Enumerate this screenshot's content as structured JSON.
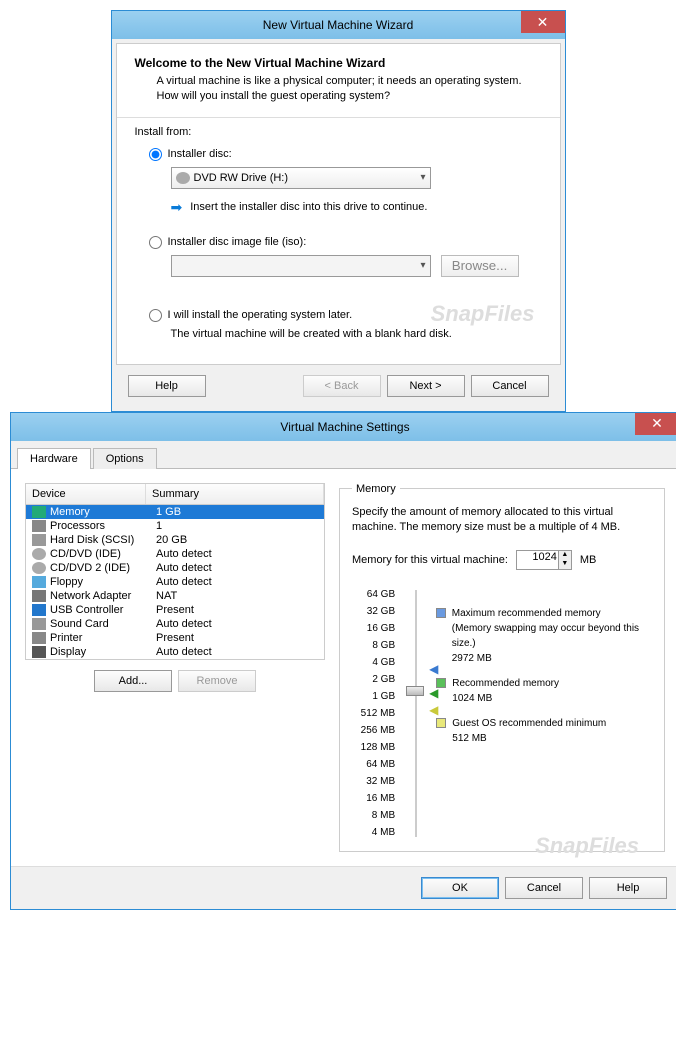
{
  "wizard": {
    "title": "New Virtual Machine Wizard",
    "heading": "Welcome to the New Virtual Machine Wizard",
    "description": "A virtual machine is like a physical computer; it needs an operating system. How will you install the guest operating system?",
    "install_from": "Install from:",
    "radio_disc": "Installer disc:",
    "drive_selected": "DVD RW Drive (H:)",
    "insert_hint": "Insert the installer disc into this drive to continue.",
    "radio_iso": "Installer disc image file (iso):",
    "browse": "Browse...",
    "radio_later": "I will install the operating system later.",
    "later_hint": "The virtual machine will be created with a blank hard disk.",
    "btn_help": "Help",
    "btn_back": "< Back",
    "btn_next": "Next >",
    "btn_cancel": "Cancel"
  },
  "settings": {
    "title": "Virtual Machine Settings",
    "tab_hardware": "Hardware",
    "tab_options": "Options",
    "col_device": "Device",
    "col_summary": "Summary",
    "devices": [
      {
        "name": "Memory",
        "summary": "1 GB",
        "icon": "ic-mem",
        "selected": true
      },
      {
        "name": "Processors",
        "summary": "1",
        "icon": "ic-cpu"
      },
      {
        "name": "Hard Disk (SCSI)",
        "summary": "20 GB",
        "icon": "ic-hd"
      },
      {
        "name": "CD/DVD (IDE)",
        "summary": "Auto detect",
        "icon": "ic-cd"
      },
      {
        "name": "CD/DVD 2 (IDE)",
        "summary": "Auto detect",
        "icon": "ic-cd"
      },
      {
        "name": "Floppy",
        "summary": "Auto detect",
        "icon": "ic-fl"
      },
      {
        "name": "Network Adapter",
        "summary": "NAT",
        "icon": "ic-net"
      },
      {
        "name": "USB Controller",
        "summary": "Present",
        "icon": "ic-usb"
      },
      {
        "name": "Sound Card",
        "summary": "Auto detect",
        "icon": "ic-snd"
      },
      {
        "name": "Printer",
        "summary": "Present",
        "icon": "ic-prn"
      },
      {
        "name": "Display",
        "summary": "Auto detect",
        "icon": "ic-dsp"
      }
    ],
    "btn_add": "Add...",
    "btn_remove": "Remove",
    "mem_legend": "Memory",
    "mem_desc": "Specify the amount of memory allocated to this virtual machine. The memory size must be a multiple of 4 MB.",
    "mem_label": "Memory for this virtual machine:",
    "mem_value": "1024",
    "mem_unit": "MB",
    "slider_marks": [
      "64 GB",
      "32 GB",
      "16 GB",
      "8 GB",
      "4 GB",
      "2 GB",
      "1 GB",
      "512 MB",
      "256 MB",
      "128 MB",
      "64 MB",
      "32 MB",
      "16 MB",
      "8 MB",
      "4 MB"
    ],
    "max_rec_label": "Maximum recommended memory",
    "max_rec_note": "(Memory swapping may occur beyond this size.)",
    "max_rec_val": "2972 MB",
    "rec_label": "Recommended memory",
    "rec_val": "1024 MB",
    "min_label": "Guest OS recommended minimum",
    "min_val": "512 MB",
    "btn_ok": "OK",
    "btn_cancel": "Cancel",
    "btn_help": "Help"
  },
  "watermark": "SnapFiles"
}
